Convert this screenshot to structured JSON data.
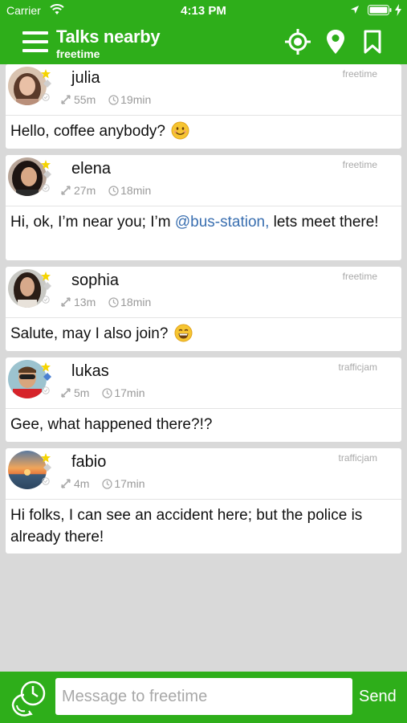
{
  "status_bar": {
    "carrier": "Carrier",
    "time": "4:13 PM",
    "icons": [
      "wifi-icon",
      "location-arrow-icon",
      "battery-icon",
      "charging-bolt-icon"
    ]
  },
  "header": {
    "title": "Talks nearby",
    "subtitle": "freetime",
    "icons": [
      "menu-icon",
      "crosshair-icon",
      "map-pin-icon",
      "bookmark-icon"
    ]
  },
  "colors": {
    "brand_green": "#2eae1a",
    "mention_blue": "#3a6fb0",
    "background": "#d9d9d9"
  },
  "posts": [
    {
      "name": "julia",
      "distance": "55m",
      "time": "19min",
      "tag": "freetime",
      "message": "Hello, coffee anybody?",
      "emoji": "smiley-face-emoji"
    },
    {
      "name": "elena",
      "distance": "27m",
      "time": "18min",
      "tag": "freetime",
      "message_before": "Hi, ok, I’m near you; I’m ",
      "mention": "@bus-station,",
      "message_after": " lets meet there!"
    },
    {
      "name": "sophia",
      "distance": "13m",
      "time": "18min",
      "tag": "freetime",
      "message": "Salute, may I also join?",
      "emoji": "grinning-face-emoji"
    },
    {
      "name": "lukas",
      "distance": "5m",
      "time": "17min",
      "tag": "trafficjam",
      "message": "Gee, what happened there?!?"
    },
    {
      "name": "fabio",
      "distance": "4m",
      "time": "17min",
      "tag": "trafficjam",
      "message": "Hi folks, I can see an accident here; but the police is already there!"
    }
  ],
  "composer": {
    "placeholder": "Message to freetime",
    "value": "",
    "send_label": "Send",
    "icon": "clock-history-icon"
  }
}
